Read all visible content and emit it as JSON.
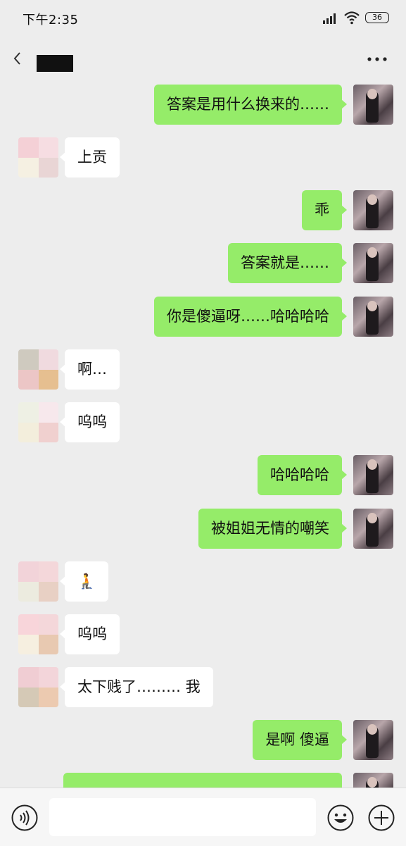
{
  "status_bar": {
    "time": "下午2:35",
    "battery": "36"
  },
  "header": {
    "title": ""
  },
  "messages": [
    {
      "side": "right",
      "text": "答案是用什么换来的……"
    },
    {
      "side": "left",
      "text": "上贡"
    },
    {
      "side": "right",
      "text": "乖"
    },
    {
      "side": "right",
      "text": "答案就是……"
    },
    {
      "side": "right",
      "text": "你是傻逼呀……哈哈哈哈"
    },
    {
      "side": "left",
      "text": "啊…"
    },
    {
      "side": "left",
      "text": "呜呜"
    },
    {
      "side": "right",
      "text": "哈哈哈哈"
    },
    {
      "side": "right",
      "text": "被姐姐无情的嘲笑"
    },
    {
      "side": "left",
      "text": "🧎"
    },
    {
      "side": "left",
      "text": "呜呜"
    },
    {
      "side": "left",
      "text": "太下贱了……… 我"
    },
    {
      "side": "right",
      "text": "是啊 傻逼"
    }
  ],
  "input": {
    "value": ""
  },
  "icons": {
    "back": "chevron-left-icon",
    "more": "more-dots-icon",
    "voice": "voice-icon",
    "emoji": "emoji-icon",
    "plus": "plus-icon"
  },
  "colors": {
    "sent_bubble": "#95ec69",
    "received_bubble": "#ffffff",
    "background": "#ededed"
  }
}
